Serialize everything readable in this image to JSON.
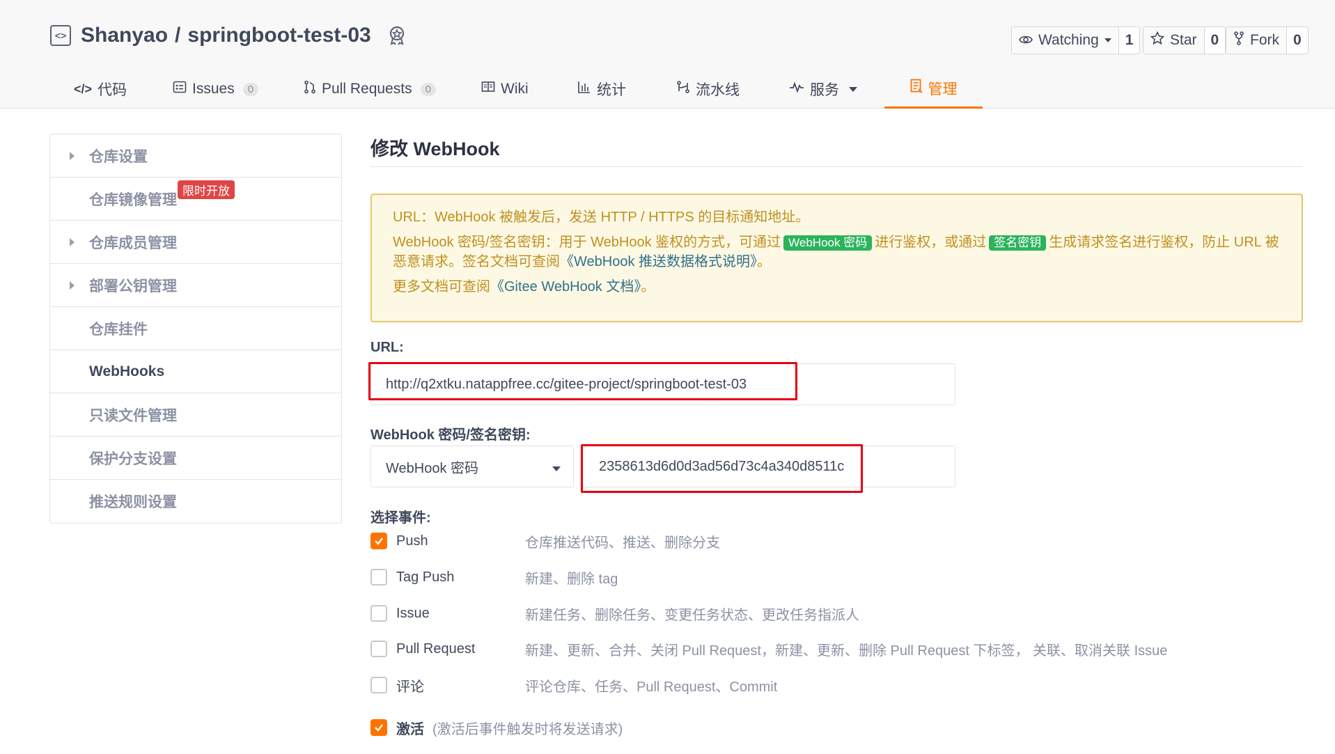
{
  "repo": {
    "owner": "Shanyao",
    "sep": "/",
    "name": "springboot-test-03"
  },
  "social": {
    "watch_label": "Watching",
    "watch_count": "1",
    "star_label": "Star",
    "star_count": "0",
    "fork_label": "Fork",
    "fork_count": "0"
  },
  "tabs": [
    {
      "label": "代码",
      "icon": "code-icon"
    },
    {
      "label": "Issues",
      "count": "0",
      "icon": "issue-icon"
    },
    {
      "label": "Pull Requests",
      "count": "0",
      "icon": "pull-request-icon"
    },
    {
      "label": "Wiki",
      "icon": "book-icon"
    },
    {
      "label": "统计",
      "icon": "bar-chart-icon"
    },
    {
      "label": "流水线",
      "icon": "pipeline-icon"
    },
    {
      "label": "服务",
      "icon": "pulse-icon"
    },
    {
      "label": "管理",
      "icon": "document-icon"
    }
  ],
  "sidebar": {
    "items": [
      {
        "label": "仓库设置"
      },
      {
        "label": "仓库镜像管理",
        "tag": "限时开放"
      },
      {
        "label": "仓库成员管理"
      },
      {
        "label": "部署公钥管理"
      },
      {
        "label": "仓库挂件"
      },
      {
        "label": "WebHooks"
      },
      {
        "label": "只读文件管理"
      },
      {
        "label": "保护分支设置"
      },
      {
        "label": "推送规则设置"
      }
    ]
  },
  "main": {
    "title": "修改 WebHook",
    "notice": {
      "line1": "URL：WebHook 被触发后，发送 HTTP / HTTPS 的目标通知地址。",
      "line2_a": "WebHook 密码/签名密钥：用于 WebHook 鉴权的方式，可通过",
      "line2_tag1": "WebHook 密码",
      "line2_b": "进行鉴权，或通过",
      "line2_tag2": "签名密钥",
      "line2_c": "生成请求签名进行鉴权，防止 URL 被恶意请求。签名文档可查阅",
      "line2_link": "《WebHook 推送数据格式说明》",
      "line2_end": "。",
      "line3_a": "更多文档可查阅",
      "line3_link": "《Gitee WebHook 文档》",
      "line3_end": "。"
    },
    "url_label": "URL:",
    "url_value": "http://q2xtku.natappfree.cc/gitee-project/springboot-test-03",
    "secret_label": "WebHook 密码/签名密钥:",
    "secret_type": "WebHook 密码",
    "secret_value": "2358613d6d0d3ad56d73c4a340d8511c",
    "events_label": "选择事件:",
    "events": [
      {
        "name": "Push",
        "desc": "仓库推送代码、推送、删除分支",
        "checked": true
      },
      {
        "name": "Tag Push",
        "desc": "新建、删除 tag",
        "checked": false
      },
      {
        "name": "Issue",
        "desc": "新建任务、删除任务、变更任务状态、更改任务指派人",
        "checked": false
      },
      {
        "name": "Pull Request",
        "desc": "新建、更新、合并、关闭 Pull Request，新建、更新、删除 Pull Request 下标签， 关联、取消关联 Issue",
        "checked": false
      },
      {
        "name": "评论",
        "desc": "评论仓库、任务、Pull Request、Commit",
        "checked": false
      }
    ],
    "activate_label": "激活",
    "activate_desc": "(激活后事件触发时将发送请求)",
    "activate_checked": true
  },
  "colors": {
    "accent": "#fe7300",
    "notice_bg": "#fcf8e3",
    "notice_text": "#c09022",
    "highlight": "#e60012"
  }
}
